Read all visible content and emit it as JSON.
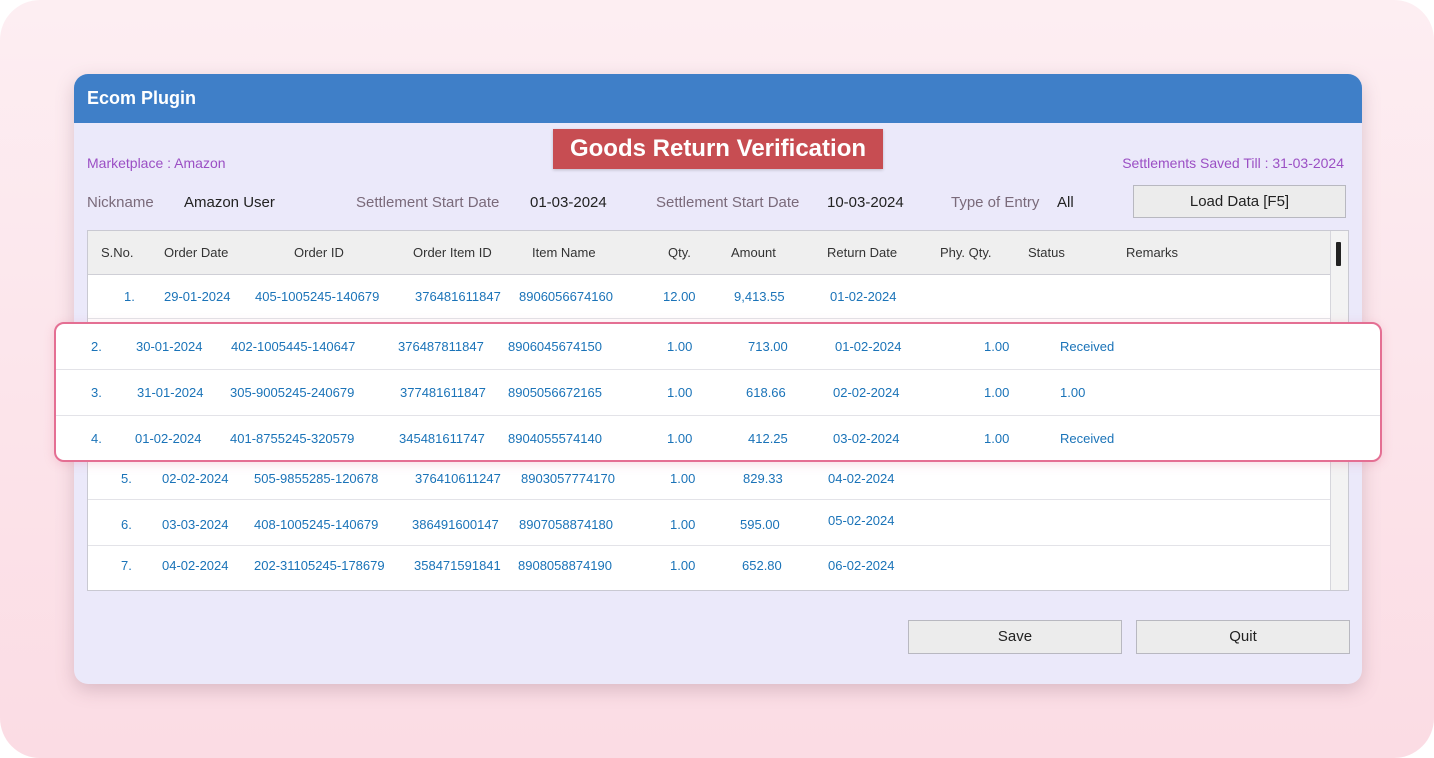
{
  "window": {
    "title": "Ecom Plugin"
  },
  "banner": "Goods Return Verification",
  "marketplace": "Marketplace : Amazon",
  "settlements_saved": "Settlements Saved Till : 31-03-2024",
  "filters": {
    "nickname_label": "Nickname",
    "nickname_value": "Amazon User",
    "start_label": "Settlement Start Date",
    "start_value": "01-03-2024",
    "end_label": "Settlement Start Date",
    "end_value": "10-03-2024",
    "entry_label": "Type of Entry",
    "entry_value": "All"
  },
  "buttons": {
    "load": "Load Data [F5]",
    "save": "Save",
    "quit": "Quit"
  },
  "columns": [
    "S.No.",
    "Order Date",
    "Order ID",
    "Order Item ID",
    "Item Name",
    "Qty.",
    "Amount",
    "Return Date",
    "Phy. Qty.",
    "Status",
    "Remarks"
  ],
  "rows": [
    {
      "sno": "1.",
      "order_date": "29-01-2024",
      "order_id": "405-1005245-140679",
      "item_id": "376481611847",
      "item_name": "8906056674160",
      "qty": "12.00",
      "amount": "9,413.55",
      "return_date": "01-02-2024",
      "phy_qty": "",
      "status": ""
    },
    {
      "sno": "5.",
      "order_date": "02-02-2024",
      "order_id": "505-9855285-120678",
      "item_id": "376410611247",
      "item_name": "8903057774170",
      "qty": "1.00",
      "amount": "829.33",
      "return_date": "04-02-2024",
      "phy_qty": "",
      "status": ""
    },
    {
      "sno": "6.",
      "order_date": "03-03-2024",
      "order_id": "408-1005245-140679",
      "item_id": "386491600147",
      "item_name": "8907058874180",
      "qty": "1.00",
      "amount": "595.00",
      "return_date": "05-02-2024",
      "phy_qty": "",
      "status": ""
    },
    {
      "sno": "7.",
      "order_date": "04-02-2024",
      "order_id": "202-31105245-178679",
      "item_id": "358471591841",
      "item_name": "8908058874190",
      "qty": "1.00",
      "amount": "652.80",
      "return_date": "06-02-2024",
      "phy_qty": "",
      "status": ""
    }
  ],
  "highlighted_rows": [
    {
      "sno": "2.",
      "order_date": "30-01-2024",
      "order_id": "402-1005445-140647",
      "item_id": "376487811847",
      "item_name": "8906045674150",
      "qty": "1.00",
      "amount": "713.00",
      "return_date": "01-02-2024",
      "phy_qty": "1.00",
      "status": "Received"
    },
    {
      "sno": "3.",
      "order_date": "31-01-2024",
      "order_id": "305-9005245-240679",
      "item_id": "377481611847",
      "item_name": "8905056672165",
      "qty": "1.00",
      "amount": "618.66",
      "return_date": "02-02-2024",
      "phy_qty": "1.00",
      "status": "1.00"
    },
    {
      "sno": "4.",
      "order_date": "01-02-2024",
      "order_id": "401-8755245-320579",
      "item_id": "345481611747",
      "item_name": "8904055574140",
      "qty": "1.00",
      "amount": "412.25",
      "return_date": "03-02-2024",
      "phy_qty": "1.00",
      "status": "Received"
    }
  ]
}
